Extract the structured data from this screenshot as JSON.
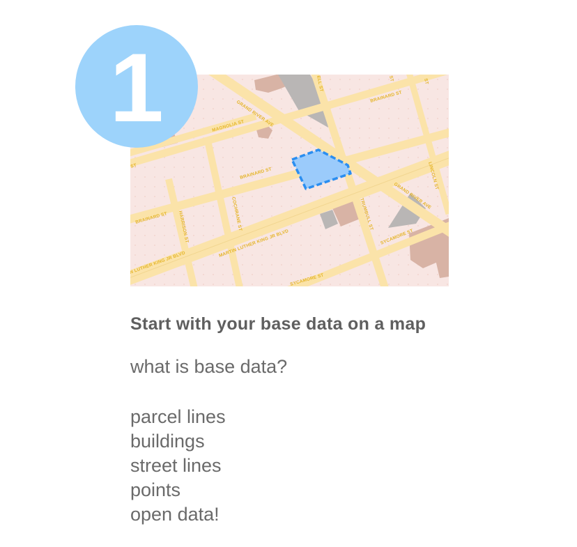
{
  "step": {
    "number": "1"
  },
  "map": {
    "colors": {
      "land": "#f8e6e3",
      "road": "#fbe3a9",
      "road_label": "#e5b52a",
      "building": "#d8b3a5",
      "gray_block": "#b9b6b5",
      "highlight_fill": "#9bcbfb",
      "highlight_stroke": "#2b8ef0"
    },
    "street_labels": {
      "grand_river_top": "GRAND RIVER AVE",
      "grand_river_bottom": "GRAND RIVER AVE",
      "brainard_top": "BRAINARD ST",
      "brainard_mid": "BRAINARD ST",
      "brainard_left": "BRAINARD ST",
      "magnolia": "MAGNOLIA ST",
      "cochrane": "COCHRANE ST",
      "harrison": "HARRISON ST",
      "trumbull": "TRUMBULL ST",
      "lincoln": "LINCOLN ST",
      "sycamore_right": "SYCAMORE ST",
      "sycamore_bottom": "SYCAMORE ST",
      "mlk_mid": "MARTIN LUTHER KING JR BLVD",
      "mlk_left": "N LUTHER KING JR BLVD",
      "top_cut_1": "ELL ST",
      "top_cut_2": "ST",
      "top_cut_3": "ST",
      "left_cut": "ST"
    }
  },
  "content": {
    "heading": "Start with your base data on a map",
    "question": "what is base data?",
    "items": [
      "parcel lines",
      "buildings",
      "street lines",
      "points",
      "open data!"
    ]
  }
}
